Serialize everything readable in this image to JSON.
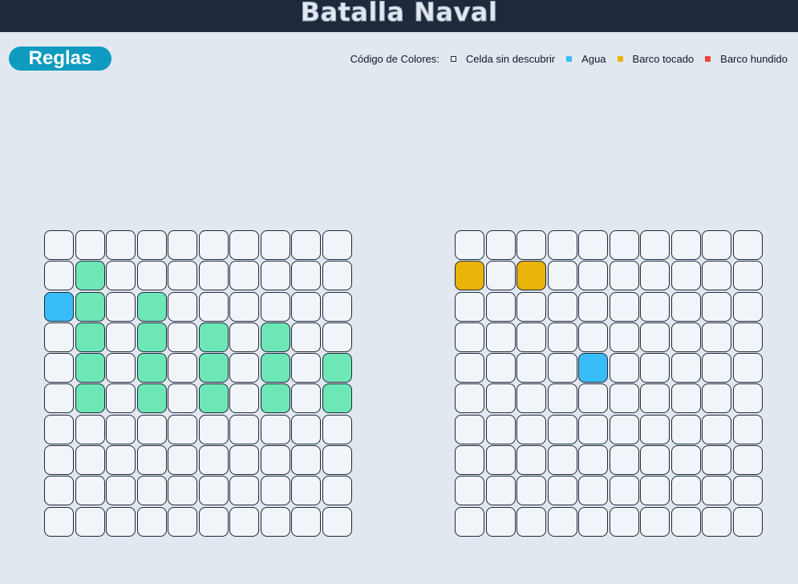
{
  "header": {
    "title": "Batalla Naval"
  },
  "rules_button": {
    "label": "Reglas"
  },
  "legend": {
    "title": "Código de Colores:",
    "items": [
      {
        "key": "hidden",
        "label": "Celda sin descubrir",
        "color": "#f1f5f9",
        "border": "#1e293b"
      },
      {
        "key": "water",
        "label": "Agua",
        "color": "#38bdf8"
      },
      {
        "key": "hit",
        "label": "Barco tocado",
        "color": "#eab308"
      },
      {
        "key": "sunk",
        "label": "Barco hundido",
        "color": "#ef4444"
      }
    ]
  },
  "colors": {
    "hidden": "#f1f5f9",
    "ship": "#6ee7b7",
    "water": "#38bdf8",
    "hit": "#eab308",
    "sunk": "#ef4444",
    "header_bg": "#1e293b",
    "page_bg": "#e2e8f0",
    "button_bg": "#0e9bbf"
  },
  "boards": {
    "player": {
      "rows": [
        [
          "e",
          "e",
          "e",
          "e",
          "e",
          "e",
          "e",
          "e",
          "e",
          "e"
        ],
        [
          "e",
          "s",
          "e",
          "e",
          "e",
          "e",
          "e",
          "e",
          "e",
          "e"
        ],
        [
          "w",
          "s",
          "e",
          "s",
          "e",
          "e",
          "e",
          "e",
          "e",
          "e"
        ],
        [
          "e",
          "s",
          "e",
          "s",
          "e",
          "s",
          "e",
          "s",
          "e",
          "e"
        ],
        [
          "e",
          "s",
          "e",
          "s",
          "e",
          "s",
          "e",
          "s",
          "e",
          "s"
        ],
        [
          "e",
          "s",
          "e",
          "s",
          "e",
          "s",
          "e",
          "s",
          "e",
          "s"
        ],
        [
          "e",
          "e",
          "e",
          "e",
          "e",
          "e",
          "e",
          "e",
          "e",
          "e"
        ],
        [
          "e",
          "e",
          "e",
          "e",
          "e",
          "e",
          "e",
          "e",
          "e",
          "e"
        ],
        [
          "e",
          "e",
          "e",
          "e",
          "e",
          "e",
          "e",
          "e",
          "e",
          "e"
        ],
        [
          "e",
          "e",
          "e",
          "e",
          "e",
          "e",
          "e",
          "e",
          "e",
          "e"
        ]
      ]
    },
    "enemy": {
      "rows": [
        [
          "e",
          "e",
          "e",
          "e",
          "e",
          "e",
          "e",
          "e",
          "e",
          "e"
        ],
        [
          "h",
          "e",
          "h",
          "e",
          "e",
          "e",
          "e",
          "e",
          "e",
          "e"
        ],
        [
          "e",
          "e",
          "e",
          "e",
          "e",
          "e",
          "e",
          "e",
          "e",
          "e"
        ],
        [
          "e",
          "e",
          "e",
          "e",
          "e",
          "e",
          "e",
          "e",
          "e",
          "e"
        ],
        [
          "e",
          "e",
          "e",
          "e",
          "w",
          "e",
          "e",
          "e",
          "e",
          "e"
        ],
        [
          "e",
          "e",
          "e",
          "e",
          "e",
          "e",
          "e",
          "e",
          "e",
          "e"
        ],
        [
          "e",
          "e",
          "e",
          "e",
          "e",
          "e",
          "e",
          "e",
          "e",
          "e"
        ],
        [
          "e",
          "e",
          "e",
          "e",
          "e",
          "e",
          "e",
          "e",
          "e",
          "e"
        ],
        [
          "e",
          "e",
          "e",
          "e",
          "e",
          "e",
          "e",
          "e",
          "e",
          "e"
        ],
        [
          "e",
          "e",
          "e",
          "e",
          "e",
          "e",
          "e",
          "e",
          "e",
          "e"
        ]
      ]
    }
  }
}
